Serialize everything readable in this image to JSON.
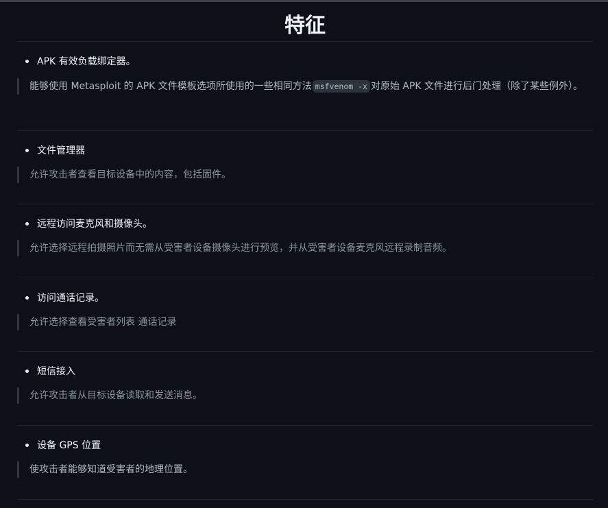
{
  "heading": "特征",
  "features": [
    {
      "title": "APK 有效负载绑定器。",
      "desc_before": "能够使用 Metasploit 的 APK 文件模板选项所使用的一些相同方法",
      "code": "msfvenom -x",
      "desc_after": "对原始 APK 文件进行后门处理（除了某些例外）。"
    },
    {
      "title": "文件管理器",
      "desc": "允许攻击者查看目标设备中的内容，包括固件。"
    },
    {
      "title": "远程访问麦克风和摄像头。",
      "desc": "允许选择远程拍摄照片而无需从受害者设备摄像头进行预览，并从受害者设备麦克风远程录制音频。"
    },
    {
      "title": "访问通话记录。",
      "desc": "允许选择查看受害者列表 通话记录"
    },
    {
      "title": "短信接入",
      "desc": "允许攻击者从目标设备读取和发送消息。"
    },
    {
      "title": "设备 GPS 位置",
      "desc": "使攻击者能够知道受害者的地理位置。"
    }
  ]
}
